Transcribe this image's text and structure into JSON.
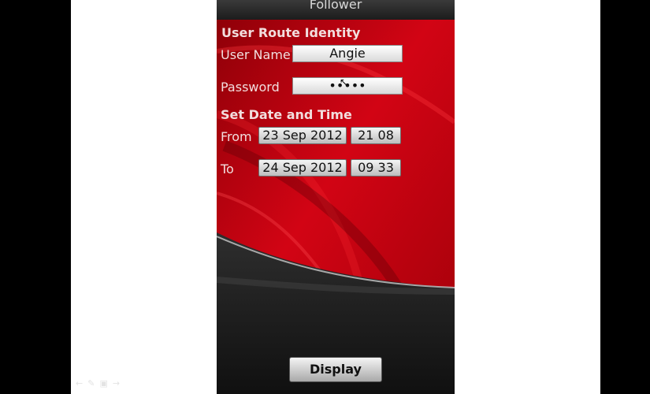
{
  "app": {
    "title": "Follower"
  },
  "identity": {
    "heading": "User Route Identity",
    "username_label": "User Name",
    "username_value": "Angie",
    "password_label": "Password",
    "password_value": "•••••"
  },
  "datetime": {
    "heading": "Set Date and Time",
    "from_label": "From",
    "from_date": "23 Sep 2012",
    "from_time": "21 08",
    "to_label": "To",
    "to_date": "24 Sep 2012",
    "to_time": "09 33"
  },
  "actions": {
    "display_label": "Display"
  },
  "colors": {
    "accent": "#c4000c",
    "dark": "#1a1a1a"
  }
}
